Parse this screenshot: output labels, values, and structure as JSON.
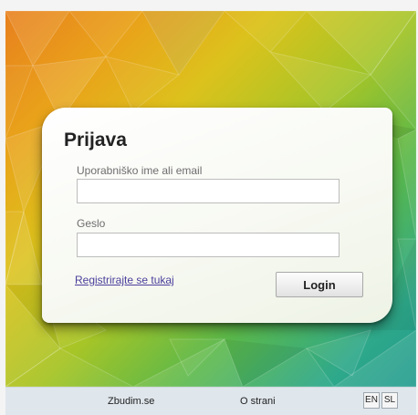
{
  "login": {
    "title": "Prijava",
    "username_label": "Uporabniško ime ali email",
    "username_value": "",
    "password_label": "Geslo",
    "password_value": "",
    "register_link": "Registrirajte se tukaj",
    "login_button": "Login"
  },
  "footer": {
    "site_link": "Zbudim.se",
    "about_link": "O strani",
    "languages": [
      "EN",
      "SL"
    ]
  },
  "colors": {
    "background_gradient": [
      "#e8801e",
      "#dcc21c",
      "#5bb84a",
      "#1f9a8e"
    ],
    "link": "#4a3e9c",
    "footer_bg": "#dfe6ec"
  }
}
